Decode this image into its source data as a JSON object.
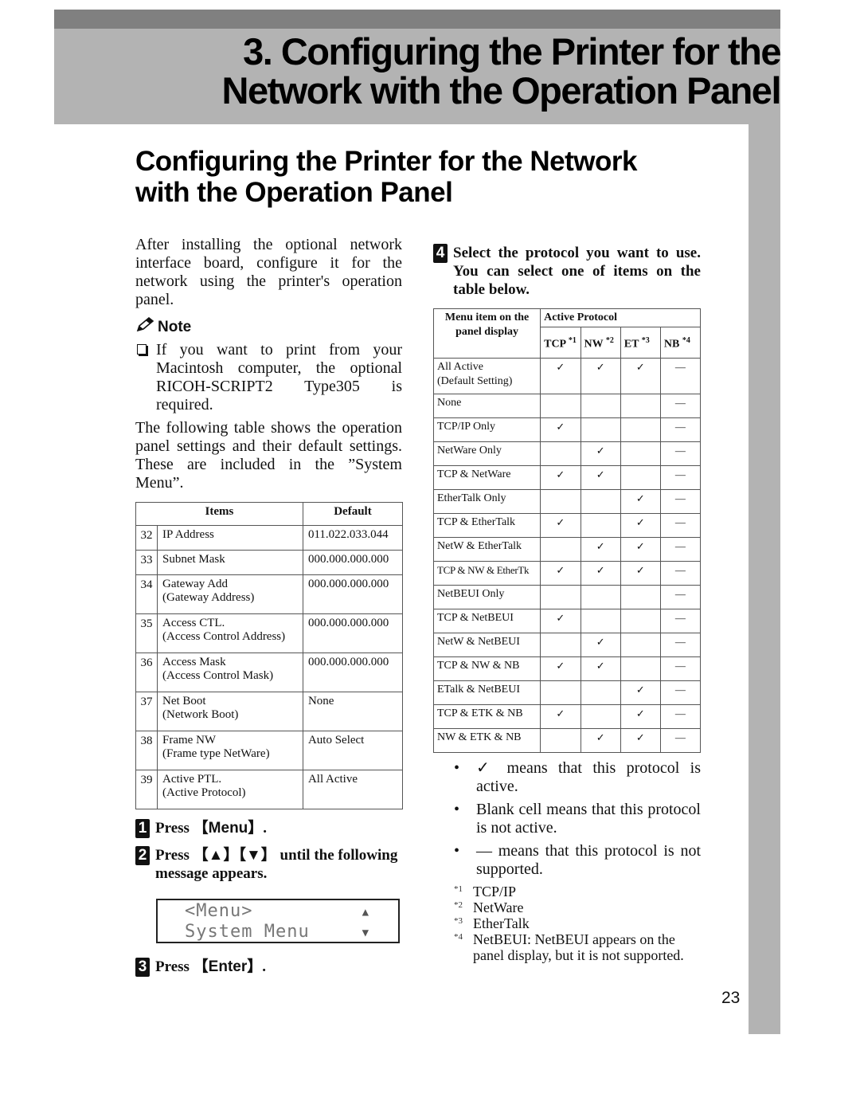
{
  "chapter": {
    "title_line1": "3. Configuring the Printer for the",
    "title_line2": "Network with the Operation Panel"
  },
  "section": {
    "title_line1": "Configuring the Printer for the Network",
    "title_line2": "with the Operation Panel"
  },
  "intro": "After installing the optional network interface board, configure it for the network using the printer's operation panel.",
  "note": {
    "icon": "pencil-icon",
    "heading": "Note",
    "items": [
      "If you want to print from your Macintosh computer, the optional RICOH-SCRIPT2 Type305 is required."
    ]
  },
  "table_intro": "The following table shows the operation panel settings and their default settings. These are included in the ”System Menu”.",
  "settings_table": {
    "headers": [
      "Items",
      "Default"
    ],
    "rows": [
      {
        "num": "32",
        "item": "IP Address",
        "sub": "",
        "default": "011.022.033.044"
      },
      {
        "num": "33",
        "item": "Subnet Mask",
        "sub": "",
        "default": "000.000.000.000"
      },
      {
        "num": "34",
        "item": "Gateway Add",
        "sub": "(Gateway Address)",
        "default": "000.000.000.000"
      },
      {
        "num": "35",
        "item": "Access CTL.",
        "sub": "(Access Control Address)",
        "default": "000.000.000.000"
      },
      {
        "num": "36",
        "item": "Access Mask",
        "sub": "(Access Control Mask)",
        "default": "000.000.000.000"
      },
      {
        "num": "37",
        "item": "Net Boot",
        "sub": "(Network Boot)",
        "default": "None"
      },
      {
        "num": "38",
        "item": "Frame NW",
        "sub": "(Frame type NetWare)",
        "default": "Auto Select"
      },
      {
        "num": "39",
        "item": "Active PTL.",
        "sub": "(Active Protocol)",
        "default": "All Active"
      }
    ]
  },
  "steps": [
    {
      "num": "1",
      "pre": "Press ",
      "key": "【Menu】",
      "post": "."
    },
    {
      "num": "2",
      "pre": "Press ",
      "key": "【▲】【▼】",
      "post": " until the following message appears."
    },
    {
      "num": "3",
      "pre": "Press ",
      "key": "【Enter】",
      "post": "."
    },
    {
      "num": "4",
      "text": "Select the protocol you want to use. You can select one of items on the table below."
    }
  ],
  "lcd": {
    "line1": "<Menu>",
    "line2": "System Menu",
    "up_indicator": "▲",
    "down_indicator": "▼"
  },
  "protocol_table": {
    "header_menu": "Menu item on the panel display",
    "header_active": "Active Protocol",
    "columns": [
      {
        "label": "TCP",
        "ref": "*1"
      },
      {
        "label": "NW",
        "ref": "*2"
      },
      {
        "label": "ET",
        "ref": "*3"
      },
      {
        "label": "NB",
        "ref": "*4"
      }
    ],
    "check_symbol": "✓",
    "unsupported_symbol": "—",
    "rows": [
      {
        "name": "All Active",
        "sub": "(Default Setting)",
        "tcp": "✓",
        "nw": "✓",
        "et": "✓",
        "nb": "—"
      },
      {
        "name": "None",
        "sub": "",
        "tcp": "",
        "nw": "",
        "et": "",
        "nb": "—"
      },
      {
        "name": "TCP/IP Only",
        "sub": "",
        "tcp": "✓",
        "nw": "",
        "et": "",
        "nb": "—"
      },
      {
        "name": "NetWare Only",
        "sub": "",
        "tcp": "",
        "nw": "✓",
        "et": "",
        "nb": "—"
      },
      {
        "name": "TCP & NetWare",
        "sub": "",
        "tcp": "✓",
        "nw": "✓",
        "et": "",
        "nb": "—"
      },
      {
        "name": "EtherTalk Only",
        "sub": "",
        "tcp": "",
        "nw": "",
        "et": "✓",
        "nb": "—"
      },
      {
        "name": "TCP & EtherTalk",
        "sub": "",
        "tcp": "✓",
        "nw": "",
        "et": "✓",
        "nb": "—"
      },
      {
        "name": "NetW & EtherTalk",
        "sub": "",
        "tcp": "",
        "nw": "✓",
        "et": "✓",
        "nb": "—"
      },
      {
        "name": "TCP & NW & EtherTk",
        "sub": "",
        "tcp": "✓",
        "nw": "✓",
        "et": "✓",
        "nb": "—"
      },
      {
        "name": "NetBEUI Only",
        "sub": "",
        "tcp": "",
        "nw": "",
        "et": "",
        "nb": "—"
      },
      {
        "name": "TCP & NetBEUI",
        "sub": "",
        "tcp": "✓",
        "nw": "",
        "et": "",
        "nb": "—"
      },
      {
        "name": "NetW & NetBEUI",
        "sub": "",
        "tcp": "",
        "nw": "✓",
        "et": "",
        "nb": "—"
      },
      {
        "name": "TCP & NW & NB",
        "sub": "",
        "tcp": "✓",
        "nw": "✓",
        "et": "",
        "nb": "—"
      },
      {
        "name": "ETalk & NetBEUI",
        "sub": "",
        "tcp": "",
        "nw": "",
        "et": "✓",
        "nb": "—"
      },
      {
        "name": "TCP & ETK & NB",
        "sub": "",
        "tcp": "✓",
        "nw": "",
        "et": "✓",
        "nb": "—"
      },
      {
        "name": "NW & ETK & NB",
        "sub": "",
        "tcp": "",
        "nw": "✓",
        "et": "✓",
        "nb": "—"
      }
    ]
  },
  "legend": [
    "✓ means that this protocol is active.",
    "Blank cell means that this protocol is not active.",
    "— means that this protocol is not supported."
  ],
  "footnotes": [
    {
      "mark": "*1",
      "text": "TCP/IP"
    },
    {
      "mark": "*2",
      "text": "NetWare"
    },
    {
      "mark": "*3",
      "text": "EtherTalk"
    },
    {
      "mark": "*4",
      "text": "NetBEUI: NetBEUI appears on the panel display, but it is not supported."
    }
  ],
  "page_number": "23",
  "colors": {
    "top_bar": "#808080",
    "band": "#b3b3b3",
    "text": "#111111"
  }
}
